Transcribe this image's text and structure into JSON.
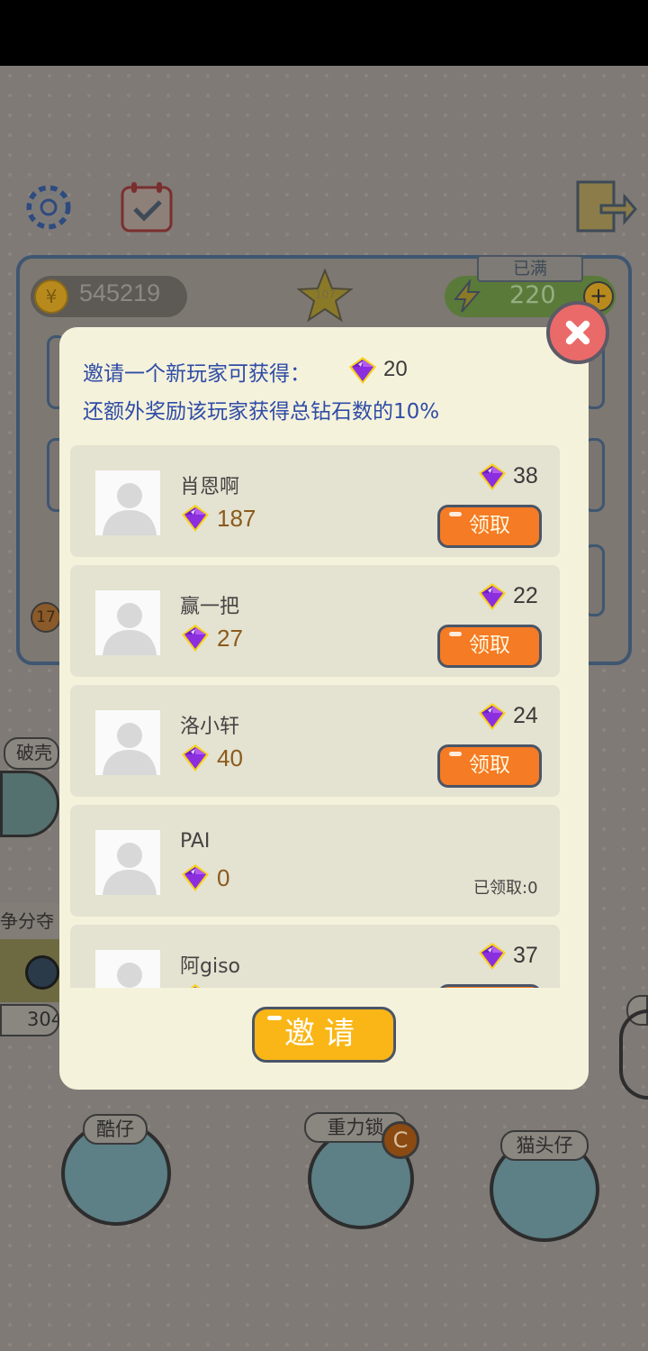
{
  "game": {
    "coins": "545219",
    "level": "107",
    "energy": "220",
    "energy_status": "已满",
    "left_labels": [
      "破壳",
      "争分夺"
    ],
    "left_small_number": "17",
    "left_bottom_number": "304",
    "characters": [
      {
        "name": "酷仔"
      },
      {
        "name": "重力锁",
        "badge": "C"
      },
      {
        "name": "猫头仔"
      }
    ]
  },
  "modal": {
    "line1_text": "邀请一个新玩家可获得：",
    "line1_reward": "20",
    "line2_text": "还额外奖励该玩家获得总钻石数的10%",
    "claim_label": "领取",
    "invite_button": "邀请",
    "players": [
      {
        "name": "肖恩啊",
        "gems": "187",
        "reward": "38",
        "status": "claim"
      },
      {
        "name": "赢一把",
        "gems": "27",
        "reward": "22",
        "status": "claim"
      },
      {
        "name": "洛小轩",
        "gems": "40",
        "reward": "24",
        "status": "claim"
      },
      {
        "name": "PAI",
        "gems": "0",
        "reward": "",
        "status": "claimed",
        "claimed_text": "已领取:0"
      },
      {
        "name": "阿giso",
        "gems": "",
        "reward": "37",
        "status": "claim"
      }
    ]
  },
  "colors": {
    "modal_bg": "#f5f2dc",
    "row_bg": "#e4e2d0",
    "claim_button": "#f57b24",
    "invite_button": "#f9b616",
    "title_text": "#2f4ca6",
    "close_button": "#ea6a6a"
  }
}
